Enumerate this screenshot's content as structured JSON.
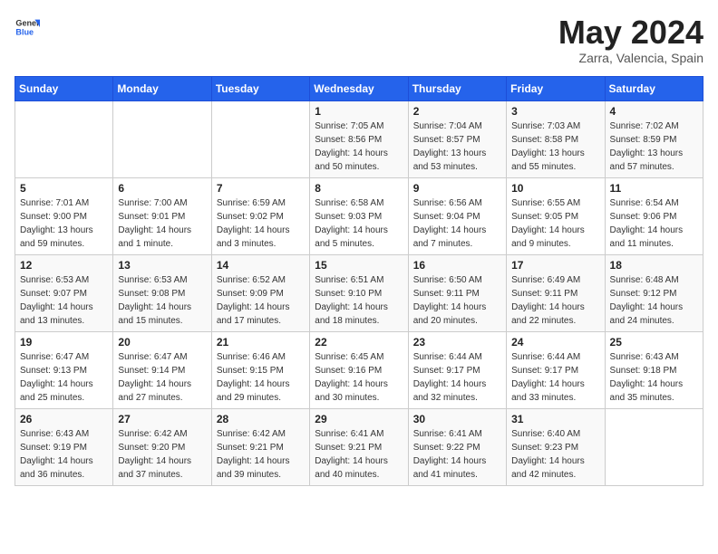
{
  "header": {
    "logo_line1": "General",
    "logo_line2": "Blue",
    "title": "May 2024",
    "subtitle": "Zarra, Valencia, Spain"
  },
  "calendar": {
    "weekdays": [
      "Sunday",
      "Monday",
      "Tuesday",
      "Wednesday",
      "Thursday",
      "Friday",
      "Saturday"
    ],
    "weeks": [
      [
        {
          "day": "",
          "sunrise": "",
          "sunset": "",
          "daylight": ""
        },
        {
          "day": "",
          "sunrise": "",
          "sunset": "",
          "daylight": ""
        },
        {
          "day": "",
          "sunrise": "",
          "sunset": "",
          "daylight": ""
        },
        {
          "day": "1",
          "sunrise": "Sunrise: 7:05 AM",
          "sunset": "Sunset: 8:56 PM",
          "daylight": "Daylight: 14 hours and 50 minutes."
        },
        {
          "day": "2",
          "sunrise": "Sunrise: 7:04 AM",
          "sunset": "Sunset: 8:57 PM",
          "daylight": "Daylight: 13 hours and 53 minutes."
        },
        {
          "day": "3",
          "sunrise": "Sunrise: 7:03 AM",
          "sunset": "Sunset: 8:58 PM",
          "daylight": "Daylight: 13 hours and 55 minutes."
        },
        {
          "day": "4",
          "sunrise": "Sunrise: 7:02 AM",
          "sunset": "Sunset: 8:59 PM",
          "daylight": "Daylight: 13 hours and 57 minutes."
        }
      ],
      [
        {
          "day": "5",
          "sunrise": "Sunrise: 7:01 AM",
          "sunset": "Sunset: 9:00 PM",
          "daylight": "Daylight: 13 hours and 59 minutes."
        },
        {
          "day": "6",
          "sunrise": "Sunrise: 7:00 AM",
          "sunset": "Sunset: 9:01 PM",
          "daylight": "Daylight: 14 hours and 1 minute."
        },
        {
          "day": "7",
          "sunrise": "Sunrise: 6:59 AM",
          "sunset": "Sunset: 9:02 PM",
          "daylight": "Daylight: 14 hours and 3 minutes."
        },
        {
          "day": "8",
          "sunrise": "Sunrise: 6:58 AM",
          "sunset": "Sunset: 9:03 PM",
          "daylight": "Daylight: 14 hours and 5 minutes."
        },
        {
          "day": "9",
          "sunrise": "Sunrise: 6:56 AM",
          "sunset": "Sunset: 9:04 PM",
          "daylight": "Daylight: 14 hours and 7 minutes."
        },
        {
          "day": "10",
          "sunrise": "Sunrise: 6:55 AM",
          "sunset": "Sunset: 9:05 PM",
          "daylight": "Daylight: 14 hours and 9 minutes."
        },
        {
          "day": "11",
          "sunrise": "Sunrise: 6:54 AM",
          "sunset": "Sunset: 9:06 PM",
          "daylight": "Daylight: 14 hours and 11 minutes."
        }
      ],
      [
        {
          "day": "12",
          "sunrise": "Sunrise: 6:53 AM",
          "sunset": "Sunset: 9:07 PM",
          "daylight": "Daylight: 14 hours and 13 minutes."
        },
        {
          "day": "13",
          "sunrise": "Sunrise: 6:53 AM",
          "sunset": "Sunset: 9:08 PM",
          "daylight": "Daylight: 14 hours and 15 minutes."
        },
        {
          "day": "14",
          "sunrise": "Sunrise: 6:52 AM",
          "sunset": "Sunset: 9:09 PM",
          "daylight": "Daylight: 14 hours and 17 minutes."
        },
        {
          "day": "15",
          "sunrise": "Sunrise: 6:51 AM",
          "sunset": "Sunset: 9:10 PM",
          "daylight": "Daylight: 14 hours and 18 minutes."
        },
        {
          "day": "16",
          "sunrise": "Sunrise: 6:50 AM",
          "sunset": "Sunset: 9:11 PM",
          "daylight": "Daylight: 14 hours and 20 minutes."
        },
        {
          "day": "17",
          "sunrise": "Sunrise: 6:49 AM",
          "sunset": "Sunset: 9:11 PM",
          "daylight": "Daylight: 14 hours and 22 minutes."
        },
        {
          "day": "18",
          "sunrise": "Sunrise: 6:48 AM",
          "sunset": "Sunset: 9:12 PM",
          "daylight": "Daylight: 14 hours and 24 minutes."
        }
      ],
      [
        {
          "day": "19",
          "sunrise": "Sunrise: 6:47 AM",
          "sunset": "Sunset: 9:13 PM",
          "daylight": "Daylight: 14 hours and 25 minutes."
        },
        {
          "day": "20",
          "sunrise": "Sunrise: 6:47 AM",
          "sunset": "Sunset: 9:14 PM",
          "daylight": "Daylight: 14 hours and 27 minutes."
        },
        {
          "day": "21",
          "sunrise": "Sunrise: 6:46 AM",
          "sunset": "Sunset: 9:15 PM",
          "daylight": "Daylight: 14 hours and 29 minutes."
        },
        {
          "day": "22",
          "sunrise": "Sunrise: 6:45 AM",
          "sunset": "Sunset: 9:16 PM",
          "daylight": "Daylight: 14 hours and 30 minutes."
        },
        {
          "day": "23",
          "sunrise": "Sunrise: 6:44 AM",
          "sunset": "Sunset: 9:17 PM",
          "daylight": "Daylight: 14 hours and 32 minutes."
        },
        {
          "day": "24",
          "sunrise": "Sunrise: 6:44 AM",
          "sunset": "Sunset: 9:17 PM",
          "daylight": "Daylight: 14 hours and 33 minutes."
        },
        {
          "day": "25",
          "sunrise": "Sunrise: 6:43 AM",
          "sunset": "Sunset: 9:18 PM",
          "daylight": "Daylight: 14 hours and 35 minutes."
        }
      ],
      [
        {
          "day": "26",
          "sunrise": "Sunrise: 6:43 AM",
          "sunset": "Sunset: 9:19 PM",
          "daylight": "Daylight: 14 hours and 36 minutes."
        },
        {
          "day": "27",
          "sunrise": "Sunrise: 6:42 AM",
          "sunset": "Sunset: 9:20 PM",
          "daylight": "Daylight: 14 hours and 37 minutes."
        },
        {
          "day": "28",
          "sunrise": "Sunrise: 6:42 AM",
          "sunset": "Sunset: 9:21 PM",
          "daylight": "Daylight: 14 hours and 39 minutes."
        },
        {
          "day": "29",
          "sunrise": "Sunrise: 6:41 AM",
          "sunset": "Sunset: 9:21 PM",
          "daylight": "Daylight: 14 hours and 40 minutes."
        },
        {
          "day": "30",
          "sunrise": "Sunrise: 6:41 AM",
          "sunset": "Sunset: 9:22 PM",
          "daylight": "Daylight: 14 hours and 41 minutes."
        },
        {
          "day": "31",
          "sunrise": "Sunrise: 6:40 AM",
          "sunset": "Sunset: 9:23 PM",
          "daylight": "Daylight: 14 hours and 42 minutes."
        },
        {
          "day": "",
          "sunrise": "",
          "sunset": "",
          "daylight": ""
        }
      ]
    ]
  }
}
